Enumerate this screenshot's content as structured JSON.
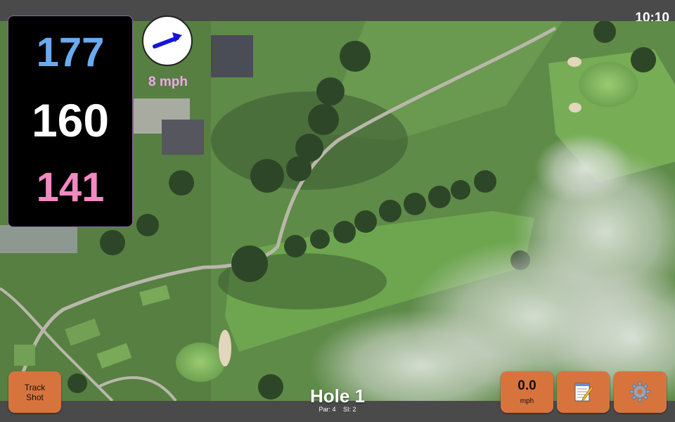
{
  "status_bar": {
    "time": "10:10"
  },
  "distances": {
    "back": "177",
    "middle": "160",
    "front": "141"
  },
  "wind": {
    "speed": "8 mph",
    "icon": "wind-arrow-icon"
  },
  "hole": {
    "title": "Hole 1",
    "par": "Par: 4",
    "stroke_index": "SI: 2"
  },
  "buttons": {
    "track_shot": {
      "line1": "Track",
      "line2": "Shot"
    },
    "speed": {
      "value": "0.0",
      "unit": "mph"
    },
    "notes": {
      "icon": "notepad-icon"
    },
    "settings": {
      "icon": "gear-icon"
    }
  },
  "colors": {
    "back_distance": "#6aaaf0",
    "middle_distance": "#ffffff",
    "front_distance": "#f08ac0",
    "wind_text": "#f0a8e8",
    "button": "#d7743e"
  }
}
